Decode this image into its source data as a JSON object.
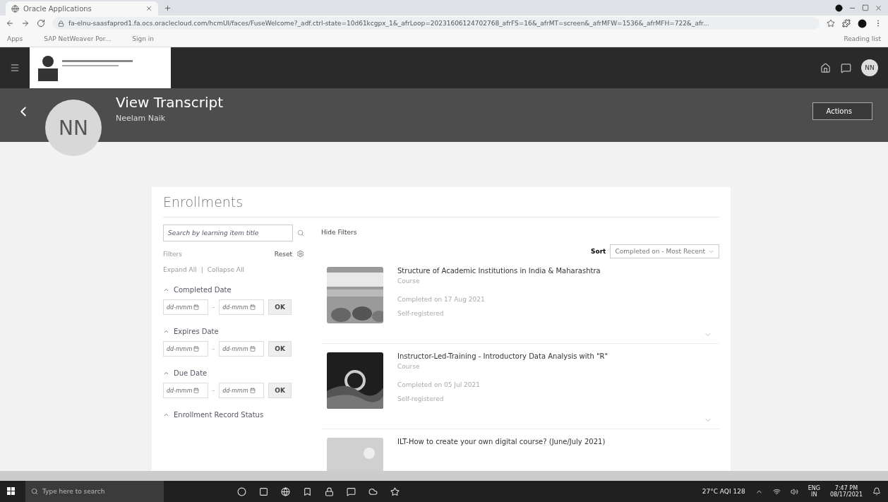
{
  "browser": {
    "tab_title": "Oracle Applications",
    "url": "fa-elnu-saasfaprod1.fa.ocs.oraclecloud.com/hcmUI/faces/FuseWelcome?_adf.ctrl-state=10d61kcgpx_1&_afrLoop=20231606124702768_afrFS=16&_afrMT=screen&_afrMFW=1536&_afrMFH=722&_afr...",
    "bookmarks": [
      "Apps",
      "SAP NetWeaver Por...",
      "Sign in",
      "Reading list"
    ]
  },
  "header": {
    "avatar": "NN"
  },
  "page": {
    "title": "View Transcript",
    "person": "Neelam Naik",
    "initials": "NN",
    "actions": "Actions"
  },
  "enrollments": {
    "title": "Enrollments",
    "search_placeholder": "Search by learning item title",
    "hide_filters": "Hide Filters",
    "filters_label": "Filters",
    "reset": "Reset",
    "expand_all": "Expand All",
    "link_separator": "|",
    "collapse_all": "Collapse All",
    "filter_groups": [
      {
        "label": "Completed Date",
        "expanded": true,
        "from": "dd-mmm",
        "range_separator": "-",
        "to": "dd-mmm",
        "ok": "OK"
      },
      {
        "label": "Expires Date",
        "expanded": true,
        "from": "dd-mmm",
        "range_separator": "-",
        "to": "dd-mmm",
        "ok": "OK"
      },
      {
        "label": "Due Date",
        "expanded": true,
        "from": "dd-mmm",
        "range_separator": "-",
        "to": "dd-mmm",
        "ok": "OK"
      },
      {
        "label": "Enrollment Record Status",
        "expanded": true
      }
    ],
    "sort_label": "Sort",
    "sort_value": "Completed on - Most Recent",
    "items": [
      {
        "title": "Structure of Academic Institutions in India & Maharashtra",
        "type": "Course",
        "completed": "Completed on 17 Aug 2021",
        "registration": "Self-registered"
      },
      {
        "title": "Instructor-Led-Training - Introductory Data Analysis with \"R\"",
        "type": "Course",
        "completed": "Completed on 05 Jul 2021",
        "registration": "Self-registered"
      },
      {
        "title": "ILT-How to create your own digital course? (June/July 2021)"
      }
    ]
  },
  "taskbar": {
    "search_placeholder": "Type here to search",
    "weather": "27°C AQI 128",
    "lang": "ENG",
    "region": "IN",
    "time": "7:47 PM",
    "date": "08/17/2021"
  }
}
